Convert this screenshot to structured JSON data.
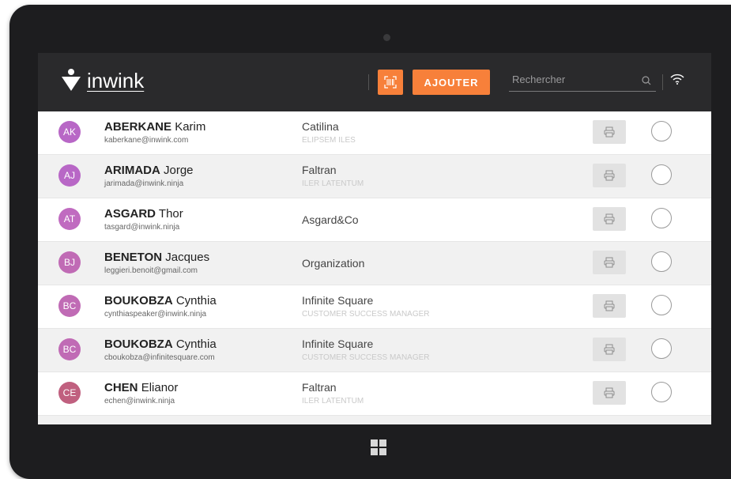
{
  "header": {
    "logo_text": "inwink",
    "add_button_label": "AJOUTER",
    "search_placeholder": "Rechercher"
  },
  "attendees": [
    {
      "initials": "AK",
      "last": "ABERKANE",
      "first": "Karim",
      "email": "kaberkane@inwink.com",
      "company": "Catilina",
      "role": "ELIPSEM ILES",
      "avatar_color": "#b867c6"
    },
    {
      "initials": "AJ",
      "last": "ARIMADA",
      "first": "Jorge",
      "email": "jarimada@inwink.ninja",
      "company": "Faltran",
      "role": "ILER LATENTUM",
      "avatar_color": "#b867c6"
    },
    {
      "initials": "AT",
      "last": "ASGARD",
      "first": "Thor",
      "email": "tasgard@inwink.ninja",
      "company": "Asgard&Co",
      "role": "",
      "avatar_color": "#c06bc0"
    },
    {
      "initials": "BJ",
      "last": "BENETON",
      "first": "Jacques",
      "email": "leggieri.benoit@gmail.com",
      "company": "Organization",
      "role": "",
      "avatar_color": "#c06bb5"
    },
    {
      "initials": "BC",
      "last": "BOUKOBZA",
      "first": "Cynthia",
      "email": "cynthiaspeaker@inwink.ninja",
      "company": "Infinite Square",
      "role": "CUSTOMER SUCCESS MANAGER",
      "avatar_color": "#c06bb5"
    },
    {
      "initials": "BC",
      "last": "BOUKOBZA",
      "first": "Cynthia",
      "email": "cboukobza@infinitesquare.com",
      "company": "Infinite Square",
      "role": "CUSTOMER SUCCESS MANAGER",
      "avatar_color": "#c06bb5"
    },
    {
      "initials": "CE",
      "last": "CHEN",
      "first": "Elianor",
      "email": "echen@inwink.ninja",
      "company": "Faltran",
      "role": "ILER LATENTUM",
      "avatar_color": "#c0607f"
    }
  ],
  "colors": {
    "accent": "#f7803a",
    "header_bg": "#2a2a2c",
    "row_alt_bg": "#f1f1f1"
  },
  "icons": {
    "scan": "qr-scan-icon",
    "search": "search-icon",
    "wifi": "wifi-icon",
    "print": "printer-icon",
    "windows": "windows-logo-icon"
  }
}
